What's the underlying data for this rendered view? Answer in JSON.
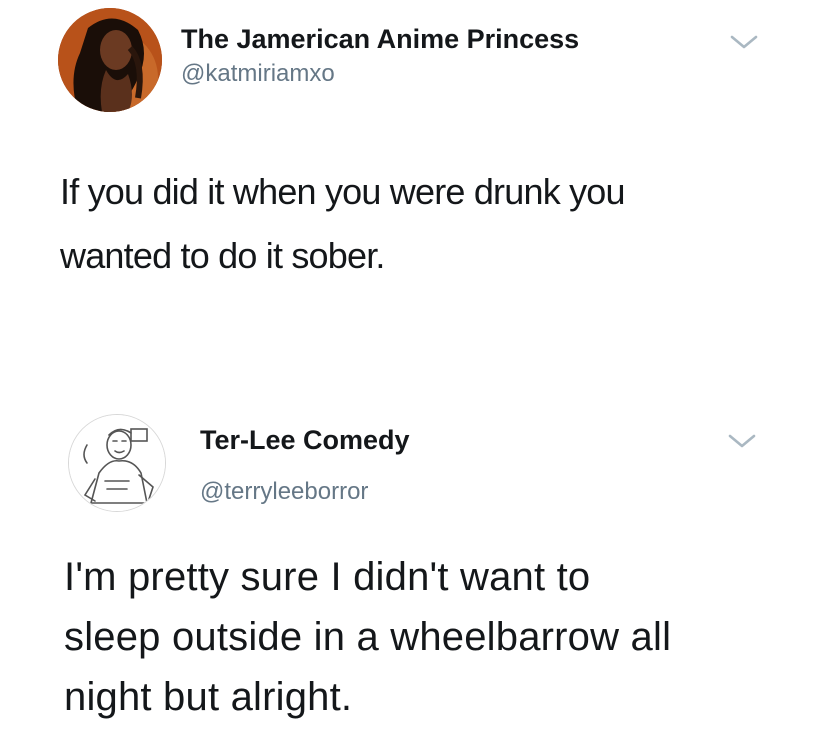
{
  "tweets": [
    {
      "display_name": "The Jamerican Anime Princess",
      "handle": "@katmiriamxo",
      "text_lines": [
        "If you did it when you were drunk you",
        "wanted to do it sober."
      ],
      "avatar_icon": "profile-photo",
      "menu_icon": "chevron-down-icon"
    },
    {
      "display_name": "Ter-Lee Comedy",
      "handle": "@terryleeborror",
      "text_lines": [
        "I'm pretty sure I didn't want to",
        "sleep outside in a wheelbarrow all",
        "night but alright."
      ],
      "avatar_icon": "sketch-profile-photo",
      "menu_icon": "chevron-down-icon"
    }
  ],
  "colors": {
    "background": "#ffffff",
    "name_text": "#14171a",
    "handle_text": "#657786",
    "chevron": "#aab8c2"
  }
}
